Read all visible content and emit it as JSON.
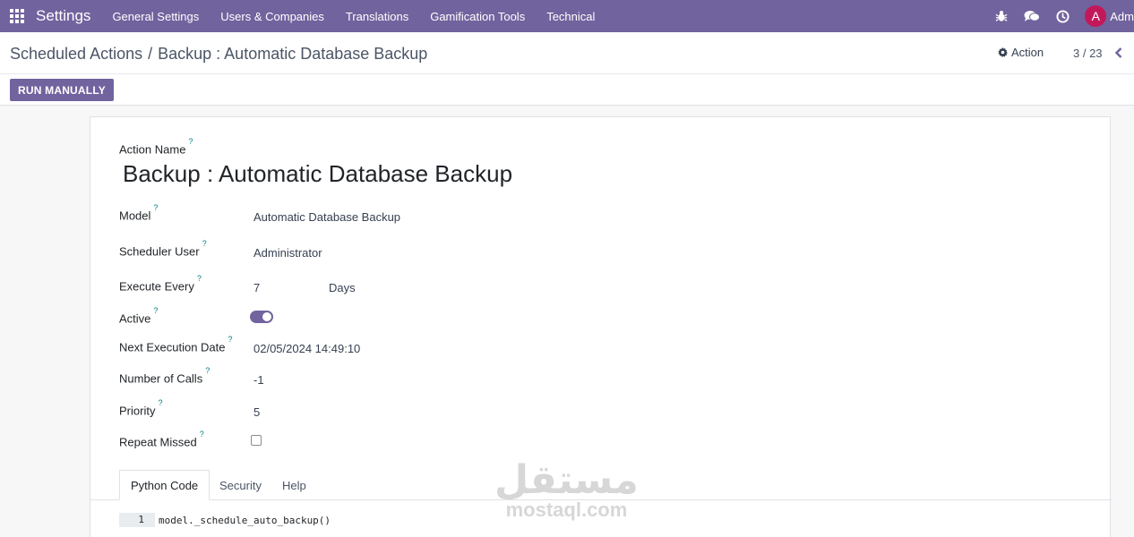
{
  "navbar": {
    "brand": "Settings",
    "menu": [
      "General Settings",
      "Users & Companies",
      "Translations",
      "Gamification Tools",
      "Technical"
    ],
    "user_initial": "A",
    "user_name": "Adm",
    "colors": {
      "bar": "#71639e",
      "avatar": "#c2185b"
    },
    "icons": [
      "apps-grid-icon",
      "bug-icon",
      "chat-icon",
      "clock-icon"
    ]
  },
  "breadcrumb": {
    "parent": "Scheduled Actions",
    "separator": "/",
    "current": "Backup : Automatic Database Backup"
  },
  "control": {
    "action_label": "Action",
    "pager": "3 / 23",
    "run_label": "RUN MANUALLY"
  },
  "form": {
    "name_label": "Action Name",
    "help_mark": "?",
    "title": "Backup : Automatic Database Backup",
    "model_label": "Model",
    "model_value": "Automatic Database Backup",
    "user_label": "Scheduler User",
    "user_value": "Administrator",
    "interval_label": "Execute Every",
    "interval_number": "7",
    "interval_unit": "Days",
    "active_label": "Active",
    "active": true,
    "nextcall_label": "Next Execution Date",
    "nextcall_value": "02/05/2024 14:49:10",
    "numbercall_label": "Number of Calls",
    "numbercall_value": "-1",
    "priority_label": "Priority",
    "priority_value": "5",
    "repeat_label": "Repeat Missed",
    "repeat_missed": false
  },
  "tabs": {
    "python": "Python Code",
    "security": "Security",
    "help": "Help",
    "active": "Python Code"
  },
  "code": {
    "line_no": "1",
    "text": "model._schedule_auto_backup()"
  },
  "watermark": {
    "arabic": "مستقل",
    "latin": "mostaql.com"
  }
}
